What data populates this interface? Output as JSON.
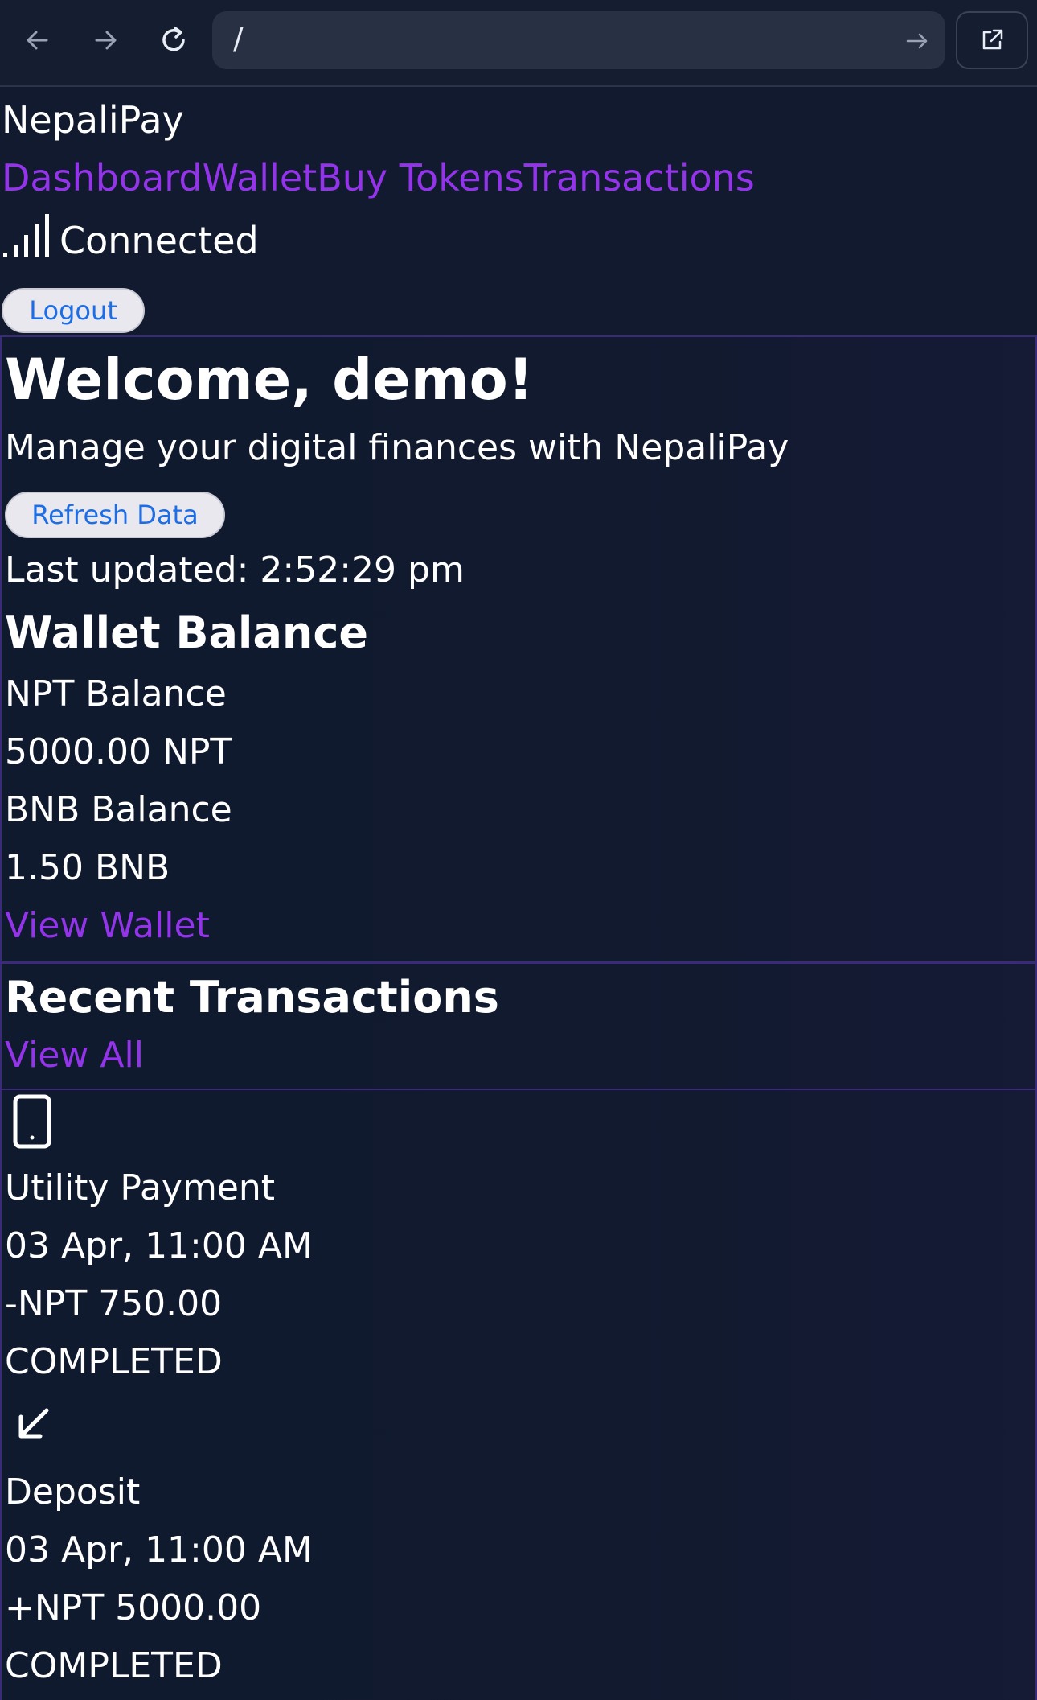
{
  "browser": {
    "address": "/"
  },
  "header": {
    "brand": "NepaliPay",
    "nav": [
      "Dashboard",
      "Wallet",
      "Buy Tokens",
      "Transactions"
    ],
    "connection_status": "Connected",
    "logout_label": "Logout"
  },
  "welcome": {
    "title": "Welcome, demo!",
    "subtitle": "Manage your digital finances with NepaliPay",
    "refresh_label": "Refresh Data",
    "last_updated": "Last updated: 2:52:29 pm"
  },
  "wallet": {
    "title": "Wallet Balance",
    "npt_label": "NPT Balance",
    "npt_value": "5000.00 NPT",
    "bnb_label": "BNB Balance",
    "bnb_value": "1.50 BNB",
    "view_link": "View Wallet"
  },
  "transactions": {
    "title": "Recent Transactions",
    "view_all": "View All",
    "items": [
      {
        "icon": "smartphone-icon",
        "name": "Utility Payment",
        "date": "03 Apr, 11:00 AM",
        "amount": "-NPT 750.00",
        "status": "COMPLETED"
      },
      {
        "icon": "arrow-down-left-icon",
        "name": "Deposit",
        "date": "03 Apr, 11:00 AM",
        "amount": "+NPT 5000.00",
        "status": "COMPLETED"
      }
    ]
  }
}
